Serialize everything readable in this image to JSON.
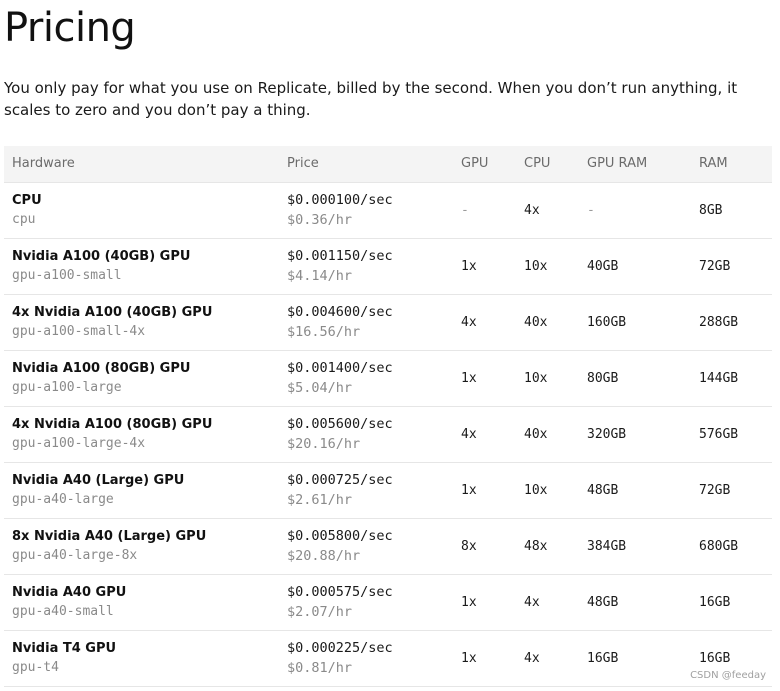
{
  "page": {
    "title": "Pricing",
    "intro": "You only pay for what you use on Replicate, billed by the second. When you don’t run anything, it scales to zero and you don’t pay a thing."
  },
  "table": {
    "headers": {
      "hardware": "Hardware",
      "price": "Price",
      "gpu": "GPU",
      "cpu": "CPU",
      "gpu_ram": "GPU RAM",
      "ram": "RAM"
    },
    "rows": [
      {
        "name": "CPU",
        "sku": "cpu",
        "price_sec": "$0.000100/sec",
        "price_hr": "$0.36/hr",
        "gpu": "-",
        "cpu": "4x",
        "gpu_ram": "-",
        "ram": "8GB"
      },
      {
        "name": "Nvidia A100 (40GB) GPU",
        "sku": "gpu-a100-small",
        "price_sec": "$0.001150/sec",
        "price_hr": "$4.14/hr",
        "gpu": "1x",
        "cpu": "10x",
        "gpu_ram": "40GB",
        "ram": "72GB"
      },
      {
        "name": "4x Nvidia A100 (40GB) GPU",
        "sku": "gpu-a100-small-4x",
        "price_sec": "$0.004600/sec",
        "price_hr": "$16.56/hr",
        "gpu": "4x",
        "cpu": "40x",
        "gpu_ram": "160GB",
        "ram": "288GB"
      },
      {
        "name": "Nvidia A100 (80GB) GPU",
        "sku": "gpu-a100-large",
        "price_sec": "$0.001400/sec",
        "price_hr": "$5.04/hr",
        "gpu": "1x",
        "cpu": "10x",
        "gpu_ram": "80GB",
        "ram": "144GB"
      },
      {
        "name": "4x Nvidia A100 (80GB) GPU",
        "sku": "gpu-a100-large-4x",
        "price_sec": "$0.005600/sec",
        "price_hr": "$20.16/hr",
        "gpu": "4x",
        "cpu": "40x",
        "gpu_ram": "320GB",
        "ram": "576GB"
      },
      {
        "name": "Nvidia A40 (Large) GPU",
        "sku": "gpu-a40-large",
        "price_sec": "$0.000725/sec",
        "price_hr": "$2.61/hr",
        "gpu": "1x",
        "cpu": "10x",
        "gpu_ram": "48GB",
        "ram": "72GB"
      },
      {
        "name": "8x Nvidia A40 (Large) GPU",
        "sku": "gpu-a40-large-8x",
        "price_sec": "$0.005800/sec",
        "price_hr": "$20.88/hr",
        "gpu": "8x",
        "cpu": "48x",
        "gpu_ram": "384GB",
        "ram": "680GB"
      },
      {
        "name": "Nvidia A40 GPU",
        "sku": "gpu-a40-small",
        "price_sec": "$0.000575/sec",
        "price_hr": "$2.07/hr",
        "gpu": "1x",
        "cpu": "4x",
        "gpu_ram": "48GB",
        "ram": "16GB"
      },
      {
        "name": "Nvidia T4 GPU",
        "sku": "gpu-t4",
        "price_sec": "$0.000225/sec",
        "price_hr": "$0.81/hr",
        "gpu": "1x",
        "cpu": "4x",
        "gpu_ram": "16GB",
        "ram": "16GB"
      }
    ]
  },
  "watermark": "CSDN @feeday"
}
